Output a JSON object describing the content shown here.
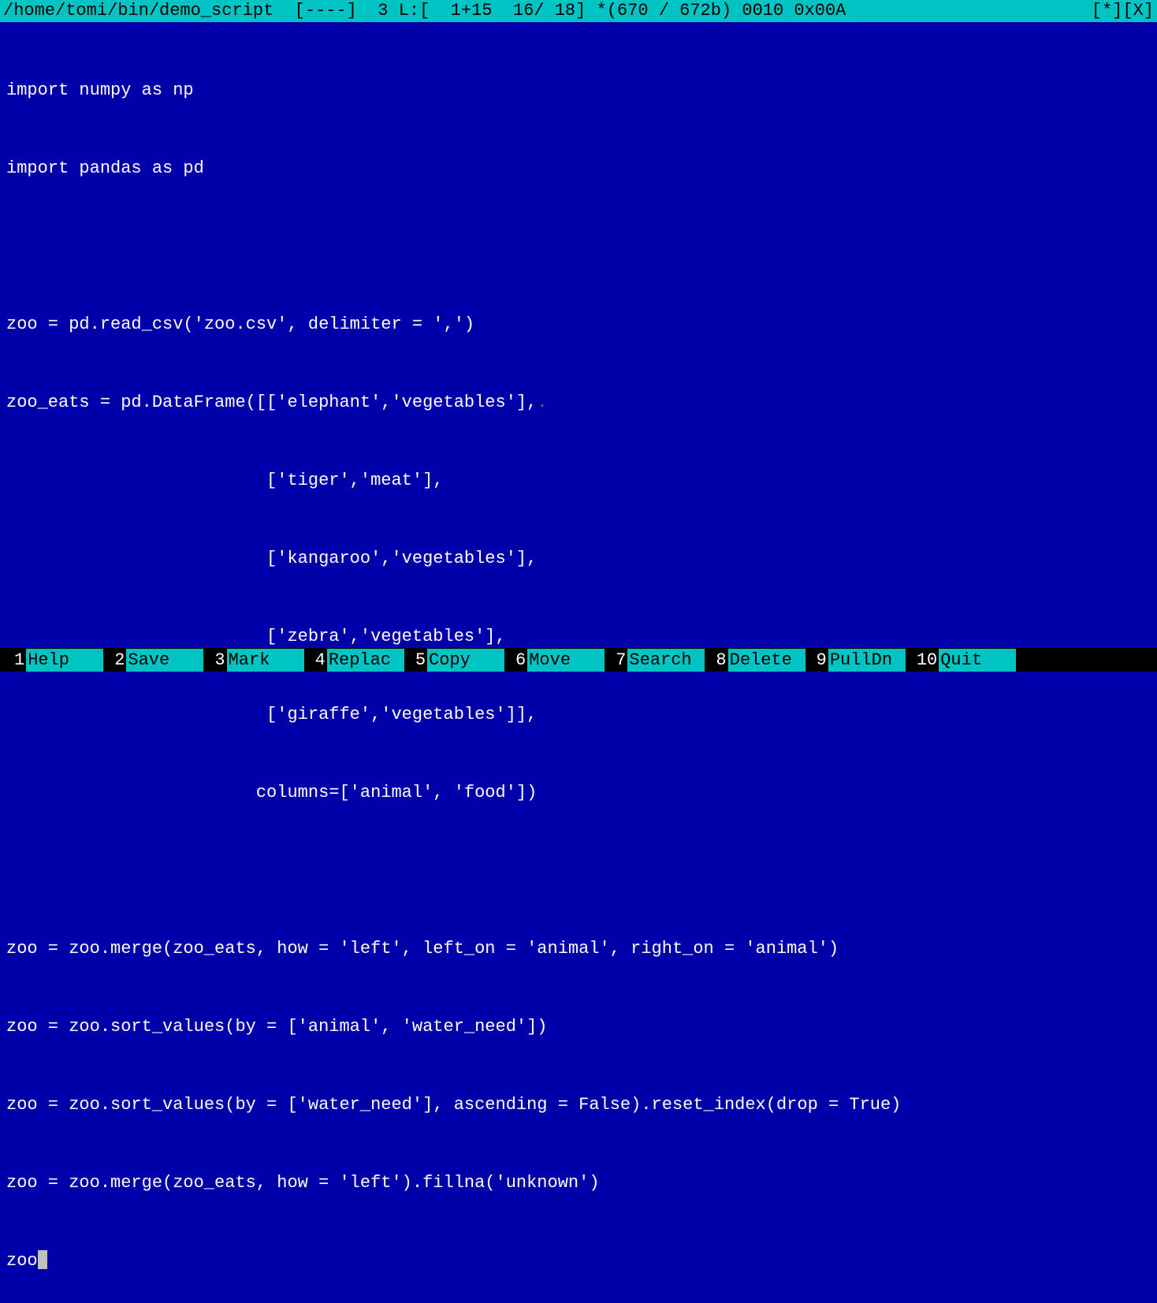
{
  "titlebar": {
    "path": "/home/tomi/bin/demo_script",
    "status": "  [----]  3 L:[  1+15  16/ 18] *(670 / 672b) 0010 0x00A",
    "right": "[*][X]"
  },
  "code": {
    "lines": [
      "import numpy as np",
      "import pandas as pd",
      "",
      "zoo = pd.read_csv('zoo.csv', delimiter = ',')",
      "zoo_eats = pd.DataFrame([['elephant','vegetables'],",
      "                         ['tiger','meat'],",
      "                         ['kangaroo','vegetables'],",
      "                         ['zebra','vegetables'],",
      "                         ['giraffe','vegetables']],",
      "                        columns=['animal', 'food'])",
      "",
      "zoo = zoo.merge(zoo_eats, how = 'left', left_on = 'animal', right_on = 'animal')",
      "zoo = zoo.sort_values(by = ['animal', 'water_need'])",
      "zoo = zoo.sort_values(by = ['water_need'], ascending = False).reset_index(drop = True)",
      "zoo = zoo.merge(zoo_eats, how = 'left').fillna('unknown')"
    ],
    "cursor_line": "zoo",
    "continuation_dot": "."
  },
  "fkeys": [
    {
      "num": "1",
      "label": "Help"
    },
    {
      "num": "2",
      "label": "Save"
    },
    {
      "num": "3",
      "label": "Mark"
    },
    {
      "num": "4",
      "label": "Replac"
    },
    {
      "num": "5",
      "label": "Copy"
    },
    {
      "num": "6",
      "label": "Move"
    },
    {
      "num": "7",
      "label": "Search"
    },
    {
      "num": "8",
      "label": "Delete"
    },
    {
      "num": "9",
      "label": "PullDn"
    },
    {
      "num": "10",
      "label": "Quit"
    }
  ]
}
